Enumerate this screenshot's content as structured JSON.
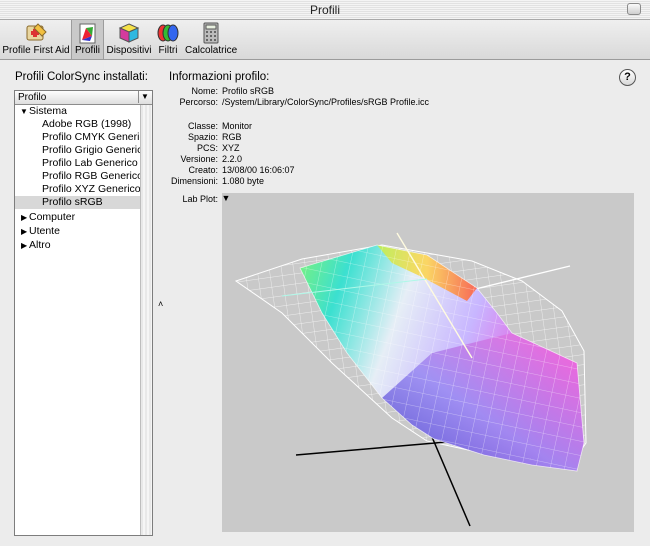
{
  "window": {
    "title": "Profili"
  },
  "toolbar": {
    "items": [
      {
        "label": "Profile First Aid",
        "icon": "first-aid-icon"
      },
      {
        "label": "Profili",
        "icon": "profiles-icon",
        "selected": true
      },
      {
        "label": "Dispositivi",
        "icon": "devices-cube-icon"
      },
      {
        "label": "Filtri",
        "icon": "filters-icon"
      },
      {
        "label": "Calcolatrice",
        "icon": "calculator-icon"
      }
    ]
  },
  "left": {
    "heading": "Profili ColorSync installati:",
    "column_header": "Profilo",
    "tree": [
      {
        "label": "Sistema",
        "expanded": true
      },
      {
        "label": "Adobe RGB (1998)"
      },
      {
        "label": "Profilo CMYK Generico"
      },
      {
        "label": "Profilo Grigio Generico"
      },
      {
        "label": "Profilo Lab Generico"
      },
      {
        "label": "Profilo RGB Generico"
      },
      {
        "label": "Profilo XYZ Generico"
      },
      {
        "label": "Profilo sRGB",
        "selected": true
      },
      {
        "label": "Computer",
        "expanded": false
      },
      {
        "label": "Utente",
        "expanded": false
      },
      {
        "label": "Altro",
        "expanded": false
      }
    ]
  },
  "info": {
    "heading": "Informazioni profilo:",
    "help": "?",
    "fields": [
      {
        "key": "Nome:",
        "value": "Profilo sRGB"
      },
      {
        "key": "Percorso:",
        "value": "/System/Library/ColorSync/Profiles/sRGB Profile.icc"
      },
      {
        "key": "Classe:",
        "value": "Monitor"
      },
      {
        "key": "Spazio:",
        "value": "RGB"
      },
      {
        "key": "PCS:",
        "value": "XYZ"
      },
      {
        "key": "Versione:",
        "value": "2.2.0"
      },
      {
        "key": "Creato:",
        "value": "13/08/00 16:06:07"
      },
      {
        "key": "Dimensioni:",
        "value": "1.080 byte"
      }
    ],
    "plot_label": "Lab Plot:"
  },
  "colors": {
    "plot_bg": "#c9c9c9",
    "selection": "#d8d8d8"
  }
}
